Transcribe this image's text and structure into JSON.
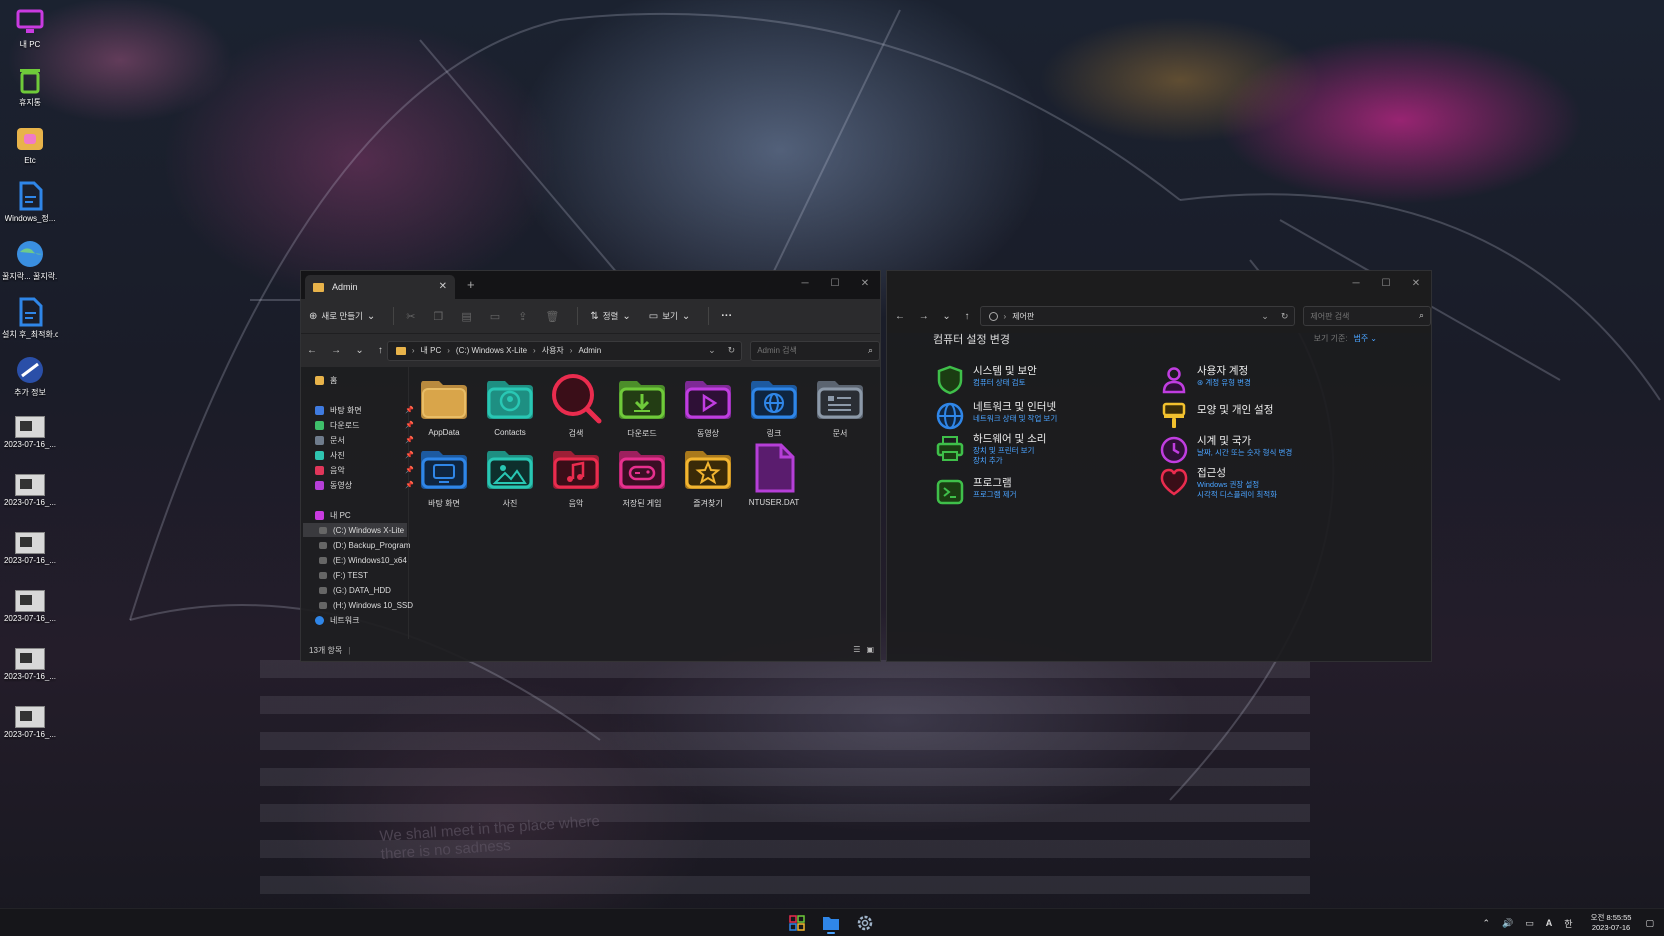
{
  "desktop": {
    "icons": [
      {
        "label": "내 PC",
        "icon": "monitor-icon"
      },
      {
        "label": "휴지통",
        "icon": "recycle-bin-icon"
      },
      {
        "label": "Etc",
        "icon": "folder-icon"
      },
      {
        "label": "Windows_정...",
        "icon": "document-icon"
      },
      {
        "label": "꿀지락... 꿀지락...",
        "icon": "globe-icon"
      },
      {
        "label": "설치 후_최적화.cmd",
        "icon": "document-icon"
      },
      {
        "label": "추가 정보",
        "icon": "info-globe-icon"
      },
      {
        "label": "2023-07-16_...",
        "icon": "screenshot-thumbnail"
      },
      {
        "label": "2023-07-16_...",
        "icon": "screenshot-thumbnail"
      },
      {
        "label": "2023-07-16_...",
        "icon": "screenshot-thumbnail"
      },
      {
        "label": "2023-07-16_...",
        "icon": "screenshot-thumbnail"
      },
      {
        "label": "2023-07-16_...",
        "icon": "screenshot-thumbnail"
      },
      {
        "label": "2023-07-16_...",
        "icon": "screenshot-thumbnail"
      }
    ],
    "wallpaper_text": "We shall meet in the place where there is no sadness"
  },
  "explorer": {
    "tab_title": "Admin",
    "new_tab": "+",
    "toolbar": {
      "new_label": "새로 만들기",
      "sort_label": "정렬",
      "view_label": "보기",
      "more_label": "···"
    },
    "breadcrumb": [
      "내 PC",
      "(C:) Windows X-Lite",
      "사용자",
      "Admin"
    ],
    "search_placeholder": "Admin 검색",
    "nav": {
      "home": "홈",
      "quick": [
        {
          "label": "바탕 화면",
          "color": "#3f7be0"
        },
        {
          "label": "다운로드",
          "color": "#3fbf6a"
        },
        {
          "label": "문서",
          "color": "#6f7c8c"
        },
        {
          "label": "사진",
          "color": "#2fc4b0"
        },
        {
          "label": "음악",
          "color": "#e0365a"
        },
        {
          "label": "동영상",
          "color": "#b63fd8"
        }
      ],
      "this_pc": "내 PC",
      "drives": [
        "(C:) Windows X-Lite",
        "(D:) Backup_Program",
        "(E:) Windows10_x64",
        "(F:) TEST",
        "(G:) DATA_HDD",
        "(H:) Windows 10_SSD"
      ],
      "network": "네트워크"
    },
    "items": [
      {
        "label": "AppData",
        "icon": "folder-icon",
        "color": "#d9a54a"
      },
      {
        "label": "Contacts",
        "icon": "contacts-folder-icon",
        "color": "#29c7b4"
      },
      {
        "label": "검색",
        "icon": "search-icon",
        "color": "#ea2c4e"
      },
      {
        "label": "다운로드",
        "icon": "download-folder-icon",
        "color": "#6fca3a"
      },
      {
        "label": "동영상",
        "icon": "video-folder-icon",
        "color": "#c03de0"
      },
      {
        "label": "링크",
        "icon": "link-globe-icon",
        "color": "#2f86e8"
      },
      {
        "label": "문서",
        "icon": "documents-folder-icon",
        "color": "#8c99a8"
      },
      {
        "label": "바탕 화면",
        "icon": "desktop-folder-icon",
        "color": "#2f86e8"
      },
      {
        "label": "사진",
        "icon": "pictures-folder-icon",
        "color": "#29c7b4"
      },
      {
        "label": "음악",
        "icon": "music-folder-icon",
        "color": "#ea2c4e"
      },
      {
        "label": "저장된 게임",
        "icon": "saved-games-folder-icon",
        "color": "#e6308e"
      },
      {
        "label": "즐겨찾기",
        "icon": "favorites-folder-icon",
        "color": "#f2b530"
      },
      {
        "label": "NTUSER.DAT",
        "icon": "file-icon",
        "color": "#b63fd8"
      }
    ],
    "status": "13개 항목"
  },
  "control_panel": {
    "breadcrumb": "제어판",
    "search_placeholder": "제어판 검색",
    "heading": "컴퓨터 설정 변경",
    "view_by_label": "보기 기준:",
    "view_by_value": "범주",
    "categories": [
      {
        "title": "시스템 및 보안",
        "links": [
          "컴퓨터 상태 검토"
        ],
        "icon": "shield-icon",
        "color": "#3fbf4a"
      },
      {
        "title": "네트워크 및 인터넷",
        "links": [
          "네트워크 상태 및 작업 보기"
        ],
        "icon": "network-globe-icon",
        "color": "#2f86e8"
      },
      {
        "title": "하드웨어 및 소리",
        "links": [
          "장치 및 프린터 보기",
          "장치 추가"
        ],
        "icon": "printer-icon",
        "color": "#3fbf4a"
      },
      {
        "title": "프로그램",
        "links": [
          "프로그램 제거"
        ],
        "icon": "programs-icon",
        "color": "#3fbf4a"
      },
      {
        "title": "사용자 계정",
        "links": [
          "계정 유형 변경"
        ],
        "icon": "user-icon",
        "color": "#c03de0"
      },
      {
        "title": "모양 및 개인 설정",
        "links": [],
        "icon": "paint-icon",
        "color": "#f2c12e"
      },
      {
        "title": "시계 및 국가",
        "links": [
          "날짜, 시간 또는 숫자 형식 변경"
        ],
        "icon": "clock-icon",
        "color": "#c03de0"
      },
      {
        "title": "접근성",
        "links": [
          "Windows 권장 설정",
          "시각적 디스플레이 최적화"
        ],
        "icon": "heart-icon",
        "color": "#ea2c4e"
      }
    ]
  },
  "taskbar": {
    "apps": [
      "start-grid-icon",
      "file-explorer-icon",
      "settings-gear-icon"
    ],
    "tray": {
      "ime": "A",
      "lang": "한"
    },
    "clock": {
      "time": "오전 8:55:55",
      "date": "2023-07-16"
    }
  }
}
